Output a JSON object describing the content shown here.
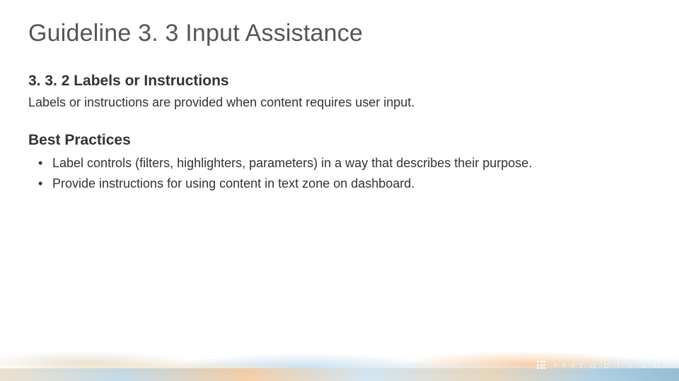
{
  "title": "Guideline 3. 3 Input Assistance",
  "section": {
    "heading": "3. 3. 2 Labels or Instructions",
    "description": "Labels or instructions are provided when content requires user input."
  },
  "best_practices": {
    "heading": "Best Practices",
    "items": [
      "Label controls (filters, highlighters, parameters) in a way that describes their purpose.",
      "Provide instructions for using content in text zone on dashboard."
    ]
  },
  "footer": {
    "logo_text": "t a b l e a u",
    "plus": "+ + +"
  }
}
